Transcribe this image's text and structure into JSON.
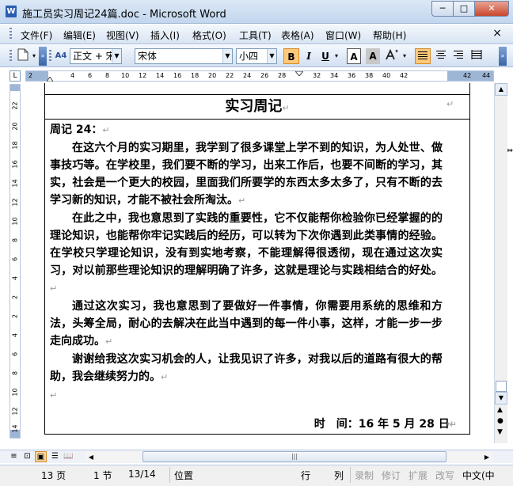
{
  "window": {
    "title": "施工员实习周记24篇.doc - Microsoft Word",
    "app_icon": "W",
    "min_glyph": "─",
    "max_glyph": "□",
    "close_glyph": "✕"
  },
  "menu": {
    "items": [
      "文件(F)",
      "编辑(E)",
      "视图(V)",
      "插入(I)",
      "格式(O)",
      "工具(T)",
      "表格(A)",
      "窗口(W)",
      "帮助(H)"
    ],
    "doc_close": "×"
  },
  "toolbar": {
    "style_value": "正文 + 宋位",
    "font_value": "宋体",
    "size_value": "小四",
    "bold_label": "B",
    "italic_label": "I",
    "underline_label": "U",
    "styles_icon_label": "A4",
    "font_color_label": "A",
    "char_border_label": "A"
  },
  "ruler": {
    "h_ticks": [
      "2",
      "2",
      "4",
      "6",
      "8",
      "10",
      "12",
      "14",
      "16",
      "18",
      "20",
      "22",
      "24",
      "26",
      "28",
      "30",
      "32",
      "34",
      "36",
      "38",
      "40",
      "42",
      "44"
    ],
    "v_ticks": [
      "22",
      "20",
      "18",
      "16",
      "14",
      "12",
      "10",
      "8",
      "6",
      "4",
      "2",
      "2",
      "4",
      "6",
      "8",
      "10",
      "12",
      "14"
    ],
    "h_last_marks": [
      "40",
      "42",
      "44"
    ]
  },
  "document": {
    "heading": "实习周记",
    "week_label": "周记 24：",
    "paragraphs": [
      "在这六个月的实习期里，我学到了很多课堂上学不到的知识，为人处世、做事技巧等。在学校里，我们要不断的学习，出来工作后，也要不间断的学习，其实，社会是一个更大的校园，里面我们所要学的东西太多太多了，只有不断的去学习新的知识，才能不被社会所淘汰。",
      "在此之中，我也意思到了实践的重要性，它不仅能帮你检验你已经掌握的的理论知识，也能帮你牢记实践后的经历，可以转为下次你遇到此类事情的经验。在学校只学理论知识，没有到实地考察，不能理解得很透彻，现在通过这次实习，对以前那些理论知识的理解明确了许多，这就是理论与实践相结合的好处。",
      "通过这次实习，我也意思到了要做好一件事情，你需要用系统的思维和方法，头筹全局，耐心的去解决在此当中遇到的每一件小事，这样，才能一步一步走向成功。",
      "谢谢给我这次实习机会的人，让我见识了许多，对我以后的道路有很大的帮助，我会继续努力的。"
    ],
    "date_line": "时　间：16 年 5 月 28 日",
    "para_mark": "↵"
  },
  "statusbar": {
    "page": "13 页",
    "section": "1 节",
    "page_of": "13/14",
    "position": "位置",
    "line": "行",
    "column": "列",
    "rec": "录制",
    "trk": "修订",
    "ext": "扩展",
    "ovr": "改写",
    "lang": "中文(中"
  }
}
